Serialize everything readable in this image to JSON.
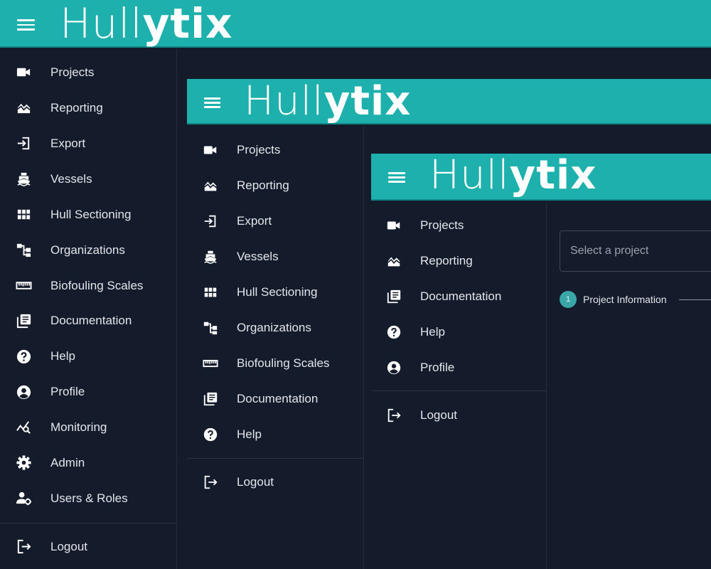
{
  "brand": {
    "logo_part1": "Hull",
    "logo_part2": "ytix",
    "accent": "#1eb0ad",
    "background": "#141c2b"
  },
  "outer": {
    "items": [
      {
        "label": "Projects",
        "icon": "video-camera-icon"
      },
      {
        "label": "Reporting",
        "icon": "area-chart-icon"
      },
      {
        "label": "Export",
        "icon": "export-icon"
      },
      {
        "label": "Vessels",
        "icon": "ship-icon"
      },
      {
        "label": "Hull Sectioning",
        "icon": "grid-icon"
      },
      {
        "label": "Organizations",
        "icon": "org-chart-icon"
      },
      {
        "label": "Biofouling Scales",
        "icon": "ruler-icon"
      },
      {
        "label": "Documentation",
        "icon": "library-books-icon"
      },
      {
        "label": "Help",
        "icon": "help-circle-icon"
      },
      {
        "label": "Profile",
        "icon": "account-circle-icon"
      },
      {
        "label": "Monitoring",
        "icon": "monitoring-icon"
      },
      {
        "label": "Admin",
        "icon": "gear-icon"
      },
      {
        "label": "Users & Roles",
        "icon": "user-gear-icon"
      }
    ],
    "logout": "Logout"
  },
  "middle": {
    "items": [
      {
        "label": "Projects",
        "icon": "video-camera-icon"
      },
      {
        "label": "Reporting",
        "icon": "area-chart-icon"
      },
      {
        "label": "Export",
        "icon": "export-icon"
      },
      {
        "label": "Vessels",
        "icon": "ship-icon"
      },
      {
        "label": "Hull Sectioning",
        "icon": "grid-icon"
      },
      {
        "label": "Organizations",
        "icon": "org-chart-icon"
      },
      {
        "label": "Biofouling Scales",
        "icon": "ruler-icon"
      },
      {
        "label": "Documentation",
        "icon": "library-books-icon"
      },
      {
        "label": "Help",
        "icon": "help-circle-icon"
      }
    ],
    "logout": "Logout"
  },
  "inner": {
    "items": [
      {
        "label": "Projects",
        "icon": "video-camera-icon"
      },
      {
        "label": "Reporting",
        "icon": "area-chart-icon"
      },
      {
        "label": "Documentation",
        "icon": "library-books-icon"
      },
      {
        "label": "Help",
        "icon": "help-circle-icon"
      },
      {
        "label": "Profile",
        "icon": "account-circle-icon"
      }
    ],
    "logout": "Logout",
    "project_select_placeholder": "Select a project",
    "step_number": "1",
    "step_label": "Project Information"
  }
}
